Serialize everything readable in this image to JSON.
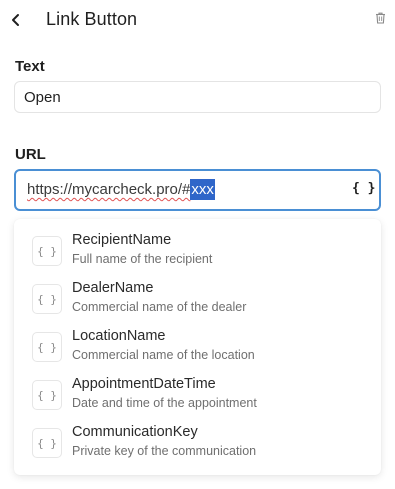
{
  "header": {
    "title": "Link Button"
  },
  "fields": {
    "text": {
      "label": "Text",
      "value": "Open"
    },
    "url": {
      "label": "URL",
      "value_prefix": "https://mycarcheck.pro/#",
      "value_selected": "xxx",
      "variable_button": "{ }"
    }
  },
  "dropdown": {
    "items": [
      {
        "icon": "{ }",
        "name": "RecipientName",
        "description": "Full name of the recipient"
      },
      {
        "icon": "{ }",
        "name": "DealerName",
        "description": "Commercial name of the dealer"
      },
      {
        "icon": "{ }",
        "name": "LocationName",
        "description": "Commercial name of the location"
      },
      {
        "icon": "{ }",
        "name": "AppointmentDateTime",
        "description": "Date and time of the appointment"
      },
      {
        "icon": "{ }",
        "name": "CommunicationKey",
        "description": "Private key of the communication"
      }
    ]
  },
  "colors": {
    "focus_border": "#4a8fd4",
    "selection": "#2f66c9",
    "spell_underline": "#e05252"
  }
}
